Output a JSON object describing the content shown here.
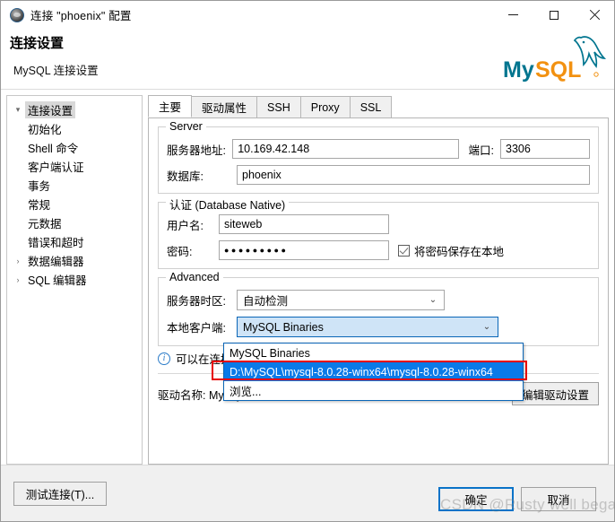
{
  "window": {
    "title": "连接 \"phoenix\" 配置",
    "icon": "dbeaver-connection-icon",
    "controls": {
      "minimize": "—",
      "maximize": "□",
      "close": "✕"
    }
  },
  "header": {
    "title": "连接设置",
    "subtitle": "MySQL 连接设置",
    "logo_alt": "MySQL",
    "logo_my": "My",
    "logo_sql": "SQL",
    "logo_teal": "#00758f",
    "logo_orange": "#f29111"
  },
  "sidebar": {
    "items": [
      {
        "label": "连接设置",
        "level": 1,
        "twisty": "▾",
        "selected": true
      },
      {
        "label": "初始化",
        "level": 2,
        "twisty": "",
        "selected": false
      },
      {
        "label": "Shell 命令",
        "level": 2,
        "twisty": "",
        "selected": false
      },
      {
        "label": "客户端认证",
        "level": 2,
        "twisty": "",
        "selected": false
      },
      {
        "label": "事务",
        "level": 2,
        "twisty": "",
        "selected": false
      },
      {
        "label": "常规",
        "level": 1,
        "twisty": "",
        "selected": false
      },
      {
        "label": "元数据",
        "level": 1,
        "twisty": "",
        "selected": false
      },
      {
        "label": "错误和超时",
        "level": 1,
        "twisty": "",
        "selected": false
      },
      {
        "label": "数据编辑器",
        "level": 1,
        "twisty": "›",
        "selected": false
      },
      {
        "label": "SQL 编辑器",
        "level": 1,
        "twisty": "›",
        "selected": false
      }
    ]
  },
  "tabs": [
    {
      "label": "主要",
      "active": true
    },
    {
      "label": "驱动属性",
      "active": false
    },
    {
      "label": "SSH",
      "active": false
    },
    {
      "label": "Proxy",
      "active": false
    },
    {
      "label": "SSL",
      "active": false
    }
  ],
  "server_group": {
    "title": "Server",
    "host_label": "服务器地址:",
    "host_value": "10.169.42.148",
    "port_label": "端口:",
    "port_value": "3306",
    "database_label": "数据库:",
    "database_value": "phoenix"
  },
  "auth_group": {
    "title": "认证 (Database Native)",
    "user_label": "用户名:",
    "user_value": "siteweb",
    "password_label": "密码:",
    "password_value": "●●●●●●●●●",
    "save_password_label": "将密码保存在本地",
    "save_password_checked": true
  },
  "advanced_group": {
    "title": "Advanced",
    "timezone_label": "服务器时区:",
    "timezone_value": "自动检测",
    "client_label": "本地客户端:",
    "client_value": "MySQL Binaries",
    "dropdown_open": true,
    "dropdown_options": [
      {
        "label": "MySQL Binaries",
        "selected": false
      },
      {
        "label": "D:\\MySQL\\mysql-8.0.28-winx64\\mysql-8.0.28-winx64",
        "selected": true
      },
      {
        "label": "浏览...",
        "selected": false
      }
    ],
    "highlight_color": "#e60000"
  },
  "info": {
    "icon": "info-icon",
    "text": "可以在连接"
  },
  "driver": {
    "label": "驱动名称: MySQL",
    "edit_button": "编辑驱动设置"
  },
  "footer": {
    "test_button": "测试连接(T)...",
    "ok_button": "确定",
    "cancel_button": "取消",
    "watermark": "CSDN @Rusty well began"
  }
}
